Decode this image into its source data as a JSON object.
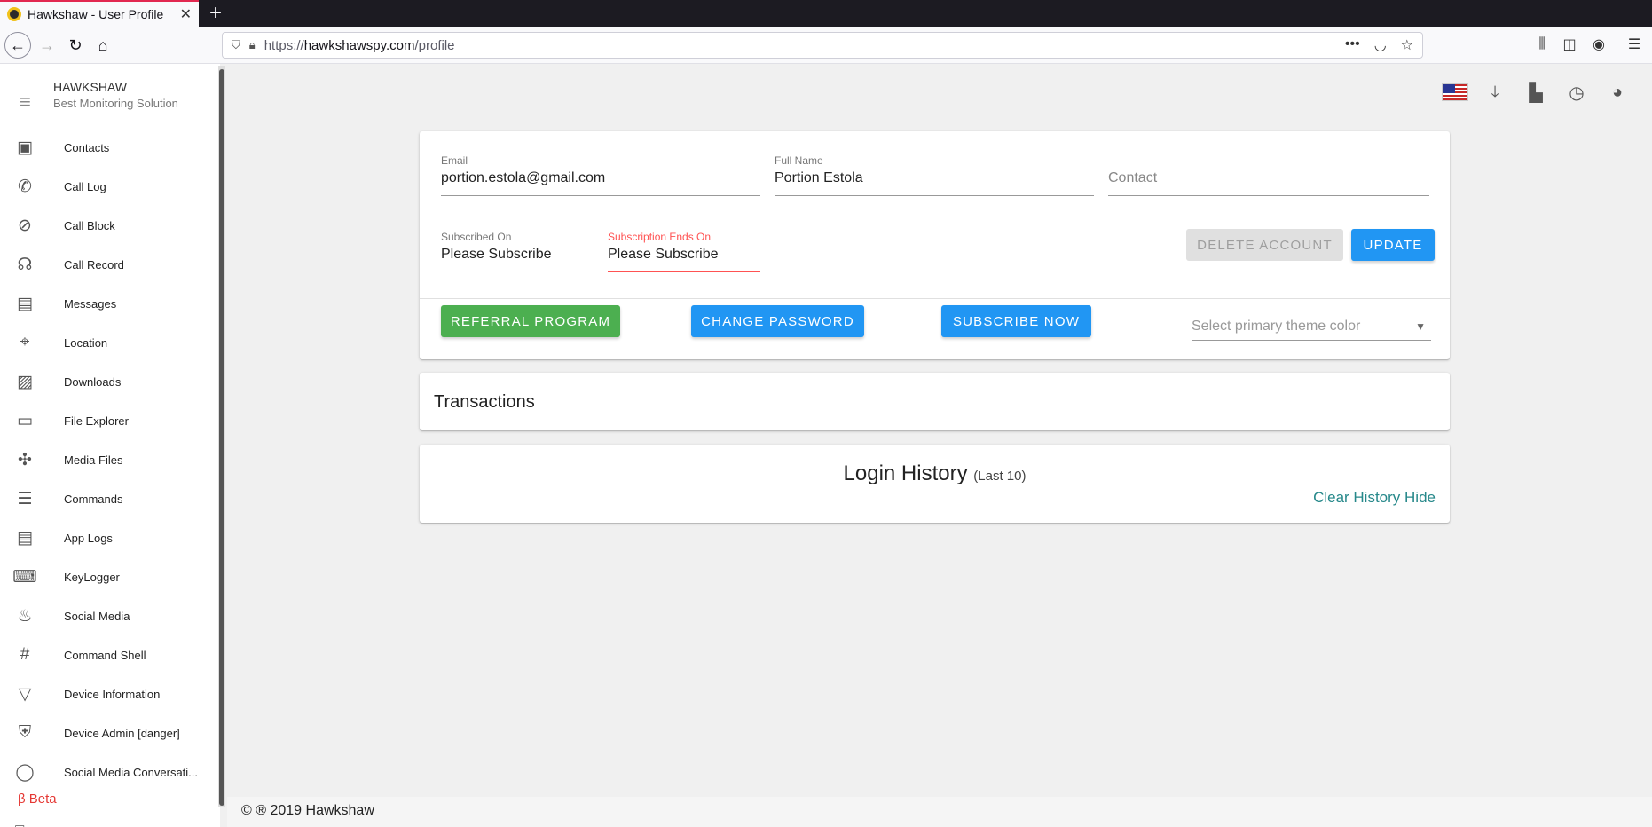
{
  "browser": {
    "tab_title": "Hawkshaw - User Profile",
    "tab_close": "✕",
    "new_tab": "+",
    "url_prefix": "https://",
    "url_domain": "hawkshawspy.com",
    "url_path": "/profile"
  },
  "brand": {
    "name": "HAWKSHAW",
    "tagline": "Best Monitoring Solution"
  },
  "sidebar": {
    "items": [
      {
        "label": "Contacts",
        "icon": "contacts-icon",
        "glyph": "▣"
      },
      {
        "label": "Call Log",
        "icon": "phone-icon",
        "glyph": "✆"
      },
      {
        "label": "Call Block",
        "icon": "block-icon",
        "glyph": "⊘"
      },
      {
        "label": "Call Record",
        "icon": "record-voice-icon",
        "glyph": "☊"
      },
      {
        "label": "Messages",
        "icon": "message-icon",
        "glyph": "▤"
      },
      {
        "label": "Location",
        "icon": "location-icon",
        "glyph": "⌖"
      },
      {
        "label": "Downloads",
        "icon": "photo-library-icon",
        "glyph": "▨"
      },
      {
        "label": "File Explorer",
        "icon": "folder-icon",
        "glyph": "▭"
      },
      {
        "label": "Media Files",
        "icon": "pinwheel-icon",
        "glyph": "✣"
      },
      {
        "label": "Commands",
        "icon": "list-icon",
        "glyph": "☰"
      },
      {
        "label": "App Logs",
        "icon": "list-alt-icon",
        "glyph": "▤"
      },
      {
        "label": "KeyLogger",
        "icon": "keyboard-icon",
        "glyph": "⌨"
      },
      {
        "label": "Social Media",
        "icon": "fire-icon",
        "glyph": "♨"
      },
      {
        "label": "Command Shell",
        "icon": "hash-icon",
        "glyph": "#"
      },
      {
        "label": "Device Information",
        "icon": "triangle-icon",
        "glyph": "▽"
      },
      {
        "label": "Device Admin [danger]",
        "icon": "shield-icon",
        "glyph": "⛨"
      },
      {
        "label": "Social Media Conversati...",
        "icon": "whatsapp-icon",
        "glyph": "◯"
      }
    ],
    "beta_label": "β Beta"
  },
  "profile": {
    "email_label": "Email",
    "email_value": "portion.estola@gmail.com",
    "fullname_label": "Full Name",
    "fullname_value": "Portion Estola",
    "contact_placeholder": "Contact",
    "subscribed_label": "Subscribed On",
    "subscribed_value": "Please Subscribe",
    "ends_label": "Subscription Ends On",
    "ends_value": "Please Subscribe",
    "delete_label": "DELETE ACCOUNT",
    "update_label": "UPDATE",
    "referral_label": "REFERRAL PROGRAM",
    "change_password_label": "CHANGE PASSWORD",
    "subscribe_label": "SUBSCRIBE NOW",
    "theme_placeholder": "Select primary theme color"
  },
  "transactions": {
    "title": "Transactions"
  },
  "login_history": {
    "title": "Login History",
    "subtitle": "(Last 10)",
    "clear_label": "Clear History Hide"
  },
  "footer": {
    "text": "© ® 2019 Hawkshaw"
  },
  "colors": {
    "accent": "#2196f3",
    "success": "#4caf50",
    "error": "#ff5252",
    "link": "#26888a"
  }
}
